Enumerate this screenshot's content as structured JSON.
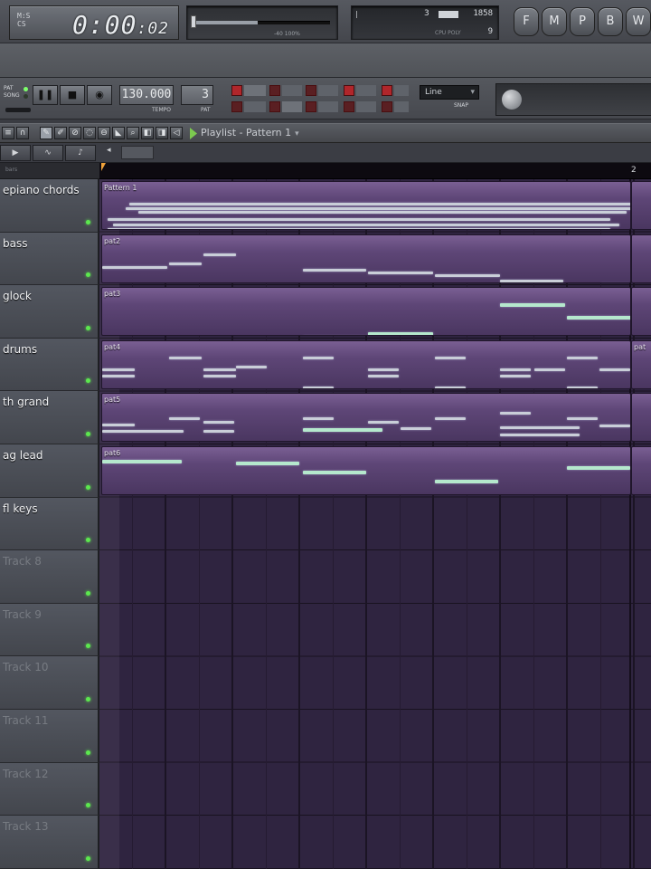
{
  "header": {
    "time_small_1": "M:S",
    "time_small_2": "CS",
    "time": "0:00",
    "time_frac": "02",
    "master_readout": "-40    100%",
    "cpu_value": "1858",
    "cpu_beat": "3",
    "poly_value": "9",
    "cpu_label": "CPU    POLY",
    "panel_left_mark": "|",
    "nav_buttons": [
      "F",
      "M",
      "P",
      "B",
      "W"
    ]
  },
  "transport": {
    "pat_label": "PAT",
    "song_label": "SONG",
    "tempo": "130.000",
    "tempo_caption": "TEMPO",
    "pattern_num": "3",
    "pattern_caption": "PAT",
    "snap": "Line",
    "snap_caption": "SNAP"
  },
  "playlist": {
    "title": "Playlist - Pattern 1",
    "dropdown": "▾",
    "ruler_left": "bars",
    "ruler_bar_2": "2"
  },
  "tracks": [
    {
      "name": "epiano chords",
      "active": true,
      "pattern": "Pattern 1"
    },
    {
      "name": "bass",
      "active": true,
      "pattern": "pat2"
    },
    {
      "name": "glock",
      "active": true,
      "pattern": "pat3"
    },
    {
      "name": "drums",
      "active": true,
      "pattern": "pat4",
      "next_pattern": "pat"
    },
    {
      "name": "th grand",
      "active": true,
      "pattern": "pat5"
    },
    {
      "name": "ag lead",
      "active": true,
      "pattern": "pat6"
    },
    {
      "name": "fl keys",
      "active": true,
      "pattern": ""
    },
    {
      "name": "Track 8",
      "active": false,
      "pattern": ""
    },
    {
      "name": "Track 9",
      "active": false,
      "pattern": ""
    },
    {
      "name": "Track 10",
      "active": false,
      "pattern": ""
    },
    {
      "name": "Track 11",
      "active": false,
      "pattern": ""
    },
    {
      "name": "Track 12",
      "active": false,
      "pattern": ""
    },
    {
      "name": "Track 13",
      "active": false,
      "pattern": ""
    }
  ],
  "colors": {
    "clip": "#5e4677",
    "note": "#c9ced8",
    "note_highlight": "#b5e8cd",
    "led": "#5ce84e",
    "tool_red": "#b0262b"
  }
}
